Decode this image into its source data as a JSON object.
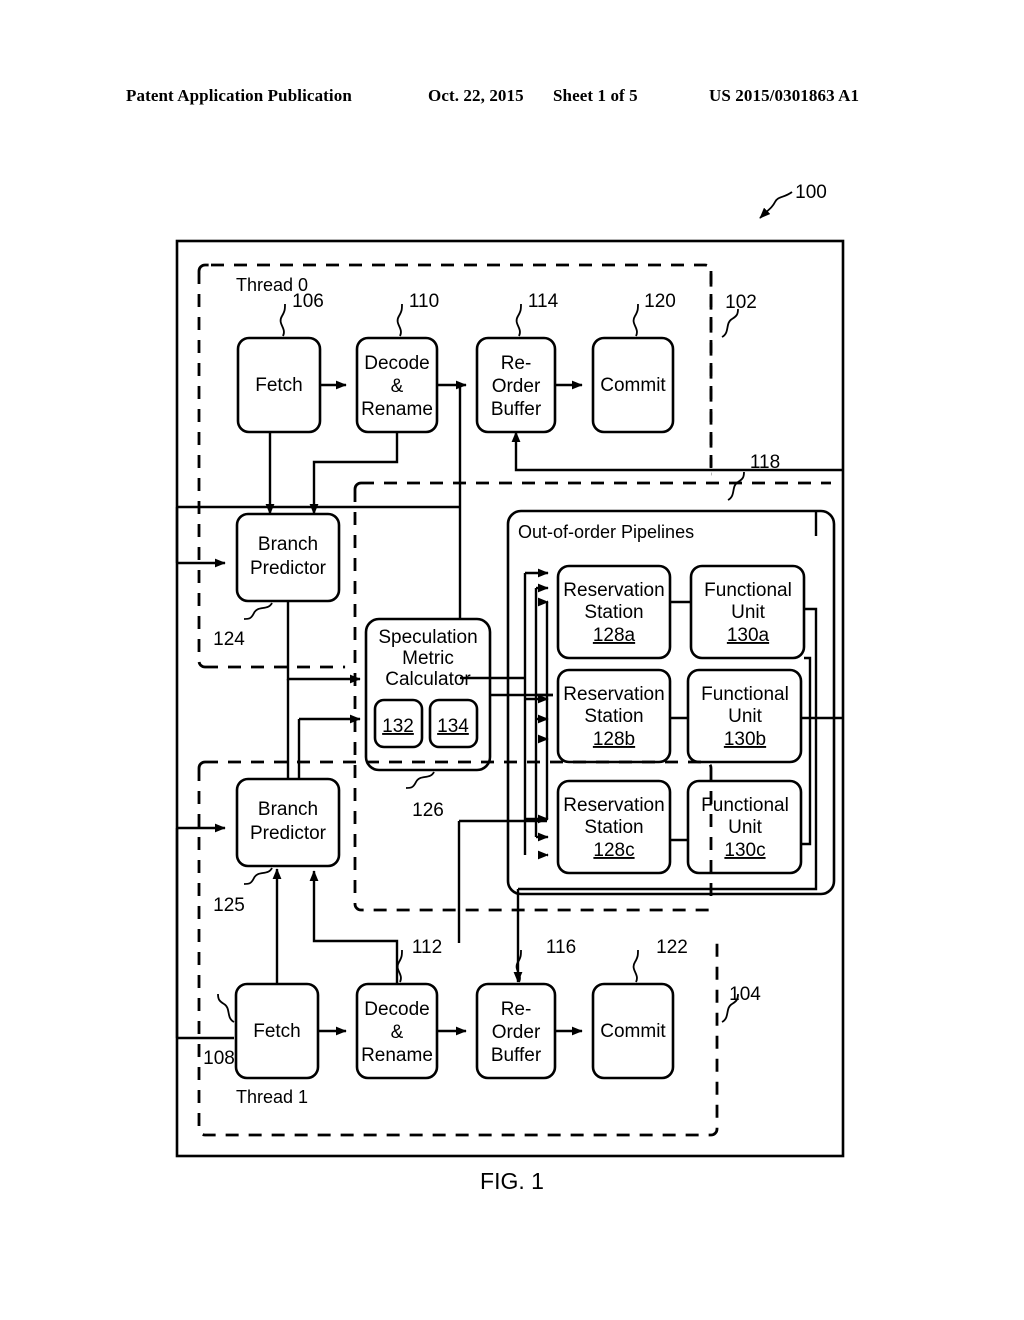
{
  "header": {
    "publication": "Patent Application Publication",
    "date": "Oct. 22, 2015",
    "sheet": "Sheet 1 of 5",
    "number": "US 2015/0301863 A1"
  },
  "figure": {
    "caption": "FIG. 1",
    "system_ref": "100"
  },
  "thread0": {
    "title": "Thread 0",
    "ref": "102",
    "blocks": [
      {
        "label": "Fetch",
        "ref": "106"
      },
      {
        "label": "Decode\n&\nRename",
        "line1": "Decode",
        "line2": "&",
        "line3": "Rename",
        "ref": "110"
      },
      {
        "label": "Re-Order Buffer",
        "line1": "Re-",
        "line2": "Order",
        "line3": "Buffer",
        "ref": "114"
      },
      {
        "label": "Commit",
        "ref": "120"
      }
    ],
    "branch_predictor": {
      "line1": "Branch",
      "line2": "Predictor",
      "ref": "124"
    }
  },
  "thread1": {
    "title": "Thread 1",
    "ref": "104",
    "blocks": [
      {
        "label": "Fetch",
        "ref": "108"
      },
      {
        "label": "Decode\n&\nRename",
        "line1": "Decode",
        "line2": "&",
        "line3": "Rename",
        "ref": "112"
      },
      {
        "label": "Re-Order Buffer",
        "line1": "Re-",
        "line2": "Order",
        "line3": "Buffer",
        "ref": "116"
      },
      {
        "label": "Commit",
        "ref": "122"
      }
    ],
    "branch_predictor": {
      "line1": "Branch",
      "line2": "Predictor",
      "ref": "125"
    }
  },
  "speculation": {
    "line1": "Speculation",
    "line2": "Metric",
    "line3": "Calculator",
    "ref": "126",
    "sub_a": "132",
    "sub_b": "134"
  },
  "pipelines": {
    "title": "Out-of-order Pipelines",
    "ref": "118",
    "rows": [
      {
        "rs_line1": "Reservation",
        "rs_line2": "Station",
        "rs_ref": "128a",
        "fu_line1": "Functional",
        "fu_line2": "Unit",
        "fu_ref": "130a"
      },
      {
        "rs_line1": "Reservation",
        "rs_line2": "Station",
        "rs_ref": "128b",
        "fu_line1": "Functional",
        "fu_line2": "Unit",
        "fu_ref": "130b"
      },
      {
        "rs_line1": "Reservation",
        "rs_line2": "Station",
        "rs_ref": "128c",
        "fu_line1": "Functional",
        "fu_line2": "Unit",
        "fu_ref": "130c"
      }
    ]
  }
}
